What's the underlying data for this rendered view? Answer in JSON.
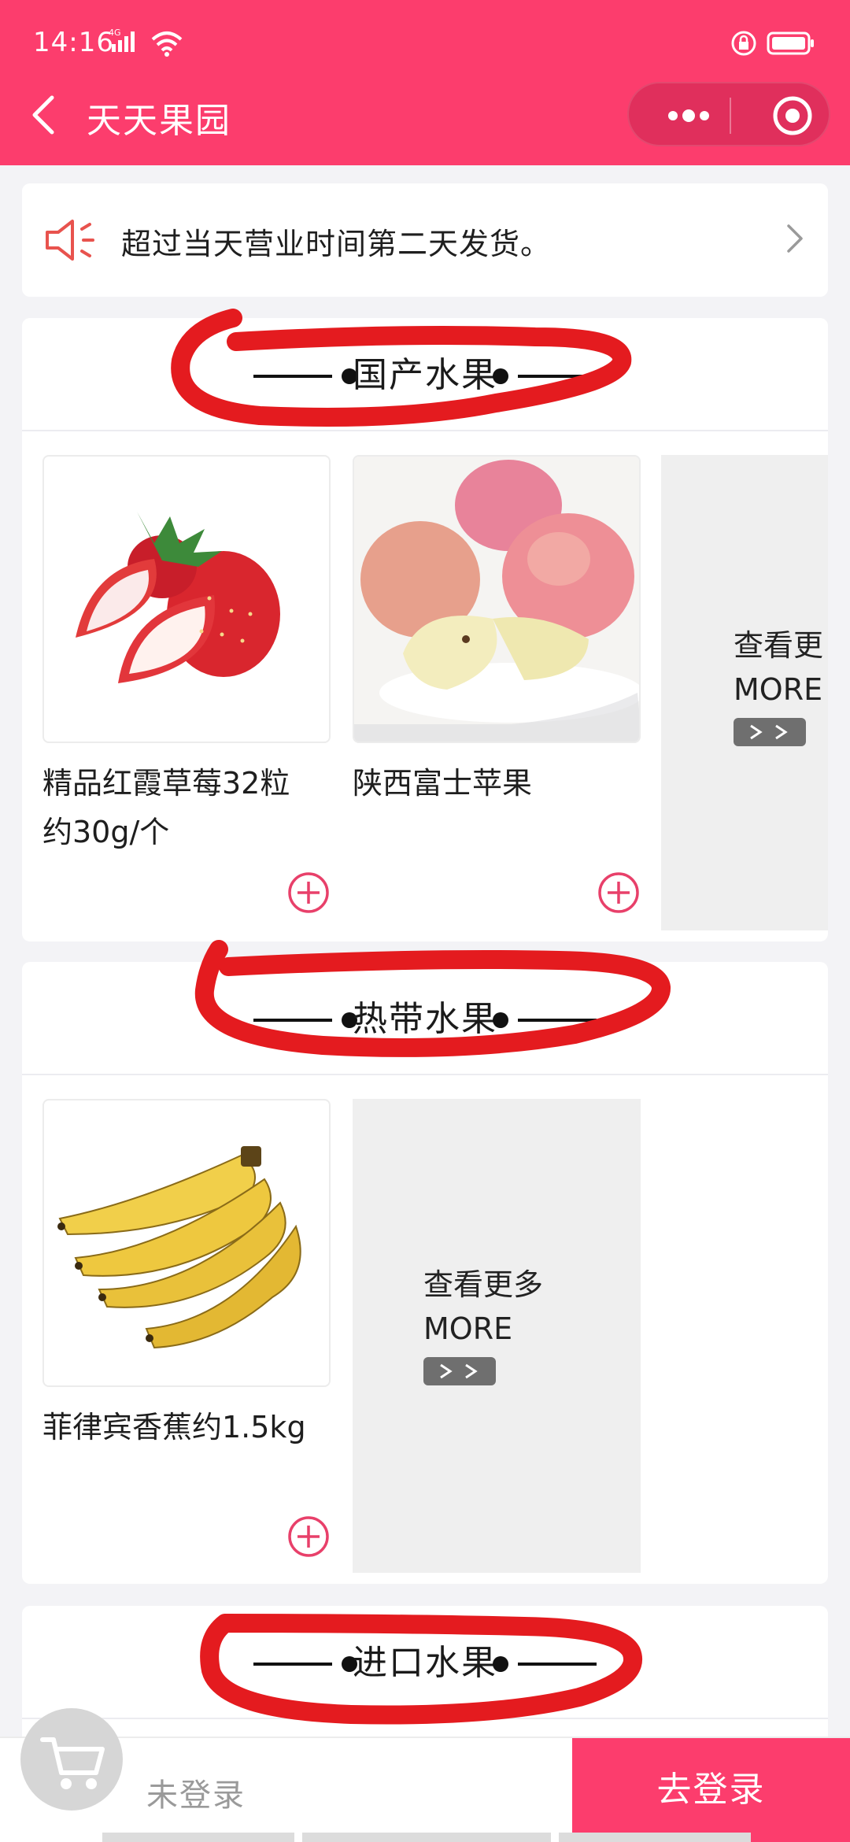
{
  "status_bar": {
    "time": "14:16",
    "network": "4G"
  },
  "nav": {
    "title": "天天果园"
  },
  "notice": {
    "text": "超过当天营业时间第二天发货。"
  },
  "sections": [
    {
      "title": "国产水果",
      "products": [
        {
          "name_line1": "精品红霞草莓32粒",
          "name_line2": "约30g/个"
        },
        {
          "name_line1": "陕西富士苹果",
          "name_line2": ""
        }
      ],
      "more": {
        "line1": "查看更",
        "line2": "MORE"
      }
    },
    {
      "title": "热带水果",
      "products": [
        {
          "name_line1": "菲律宾香蕉约1.5kg",
          "name_line2": ""
        }
      ],
      "more": {
        "line1": "查看更多",
        "line2": "MORE"
      }
    },
    {
      "title": "进口水果"
    }
  ],
  "bottom_bar": {
    "status": "未登录",
    "login_button": "去登录"
  },
  "colors": {
    "brand": "#fc3d6d",
    "annotation": "#e41b1f",
    "page_bg": "#f3f3f6"
  }
}
